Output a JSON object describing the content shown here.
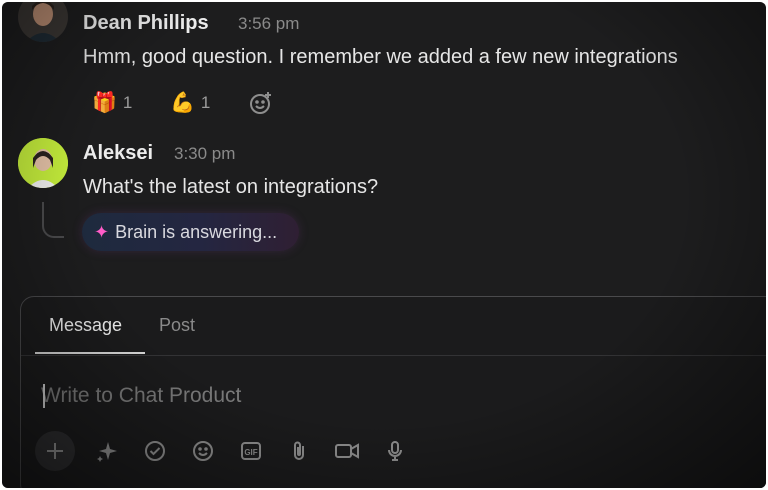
{
  "messages": [
    {
      "author": "Dean Phillips",
      "time": "3:56 pm",
      "text": "Hmm, good question. I remember we added a few new integrations",
      "reactions": [
        {
          "emoji": "🎁",
          "count": "1"
        },
        {
          "emoji": "💪",
          "count": "1"
        }
      ],
      "add_reaction_icon": "add-reaction-icon"
    },
    {
      "author": "Aleksei",
      "time": "3:30 pm",
      "text": "What's the latest on integrations?"
    }
  ],
  "brain": {
    "icon": "sparkle-icon",
    "label": "Brain is answering..."
  },
  "composer": {
    "tabs": [
      "Message",
      "Post"
    ],
    "active_tab": "Message",
    "placeholder": "Write to Chat Product",
    "value": "",
    "toolbar_icons": [
      "plus-icon",
      "sparkle-icon",
      "checklist-icon",
      "emoji-icon",
      "gif-icon",
      "attachment-icon",
      "video-icon",
      "microphone-icon"
    ]
  },
  "colors": {
    "background": "#1d1d1e",
    "aleksei_avatar_ring": "#c6ef3c",
    "brain_sparkle": "#ff5cc8"
  }
}
